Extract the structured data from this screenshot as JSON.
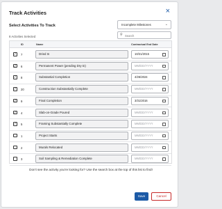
{
  "dialog": {
    "title": "Track Activities",
    "close_icon": "×",
    "select_label": "Select Activities To Track",
    "filter_select": {
      "value": "Incomplete Milestones",
      "icon": "chevron-down-icon"
    },
    "count_text": "8 Activities Selected",
    "search": {
      "placeholder": "Search",
      "icon": "search-icon"
    },
    "columns": {
      "id": "ID",
      "name": "Name",
      "date": "Contractual End Date"
    },
    "rows": [
      {
        "checked": true,
        "id": "7",
        "name": "Dried In",
        "date": "10/21/2015"
      },
      {
        "checked": true,
        "id": "6",
        "name": "Permanent Power (pending Dry-in)",
        "date": "MM/DD/YYYY"
      },
      {
        "checked": true,
        "id": "8",
        "name": "Substantial Completion",
        "date": "4/26/2024"
      },
      {
        "checked": true,
        "id": "20",
        "name": "Construction Substantially Complete",
        "date": "MM/DD/YYYY"
      },
      {
        "checked": true,
        "id": "9",
        "name": "Final Completion",
        "date": "3/31/2016"
      },
      {
        "checked": true,
        "id": "4",
        "name": "Slab-on-Grade Poured",
        "date": "MM/DD/YYYY"
      },
      {
        "checked": true,
        "id": "5",
        "name": "Framing Substantially Complete",
        "date": "MM/DD/YYYY"
      },
      {
        "checked": false,
        "id": "1",
        "name": "Project Starts",
        "date": "MM/DD/YYYY"
      },
      {
        "checked": false,
        "id": "2",
        "name": "Murals Relocated",
        "date": "MM/DD/YYYY"
      },
      {
        "checked": false,
        "id": "3",
        "name": "Soil Sampling & Remediation Complete",
        "date": "MM/DD/YYYY"
      }
    ],
    "hint": "Don't see the activity you're looking for? Use the search box at the top of this list to find!",
    "buttons": {
      "save": "Save",
      "cancel": "Cancel"
    },
    "colors": {
      "accent": "#1c5aa6",
      "danger": "#c62828"
    }
  }
}
